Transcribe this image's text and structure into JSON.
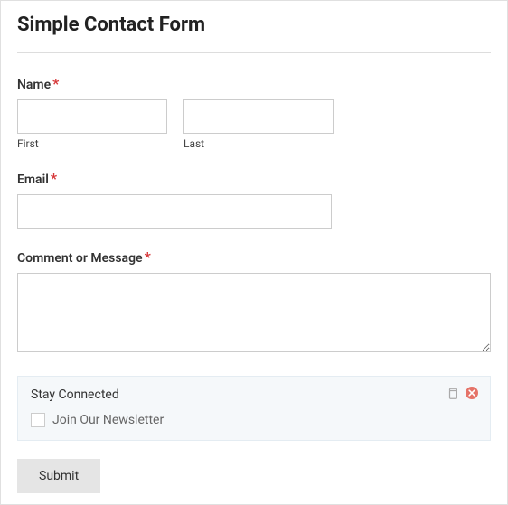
{
  "title": "Simple Contact Form",
  "name": {
    "label": "Name",
    "required": "*",
    "first_sublabel": "First",
    "last_sublabel": "Last"
  },
  "email": {
    "label": "Email",
    "required": "*"
  },
  "comment": {
    "label": "Comment or Message",
    "required": "*"
  },
  "newsletter": {
    "title": "Stay Connected",
    "option": "Join Our Newsletter"
  },
  "submit": {
    "label": "Submit"
  }
}
